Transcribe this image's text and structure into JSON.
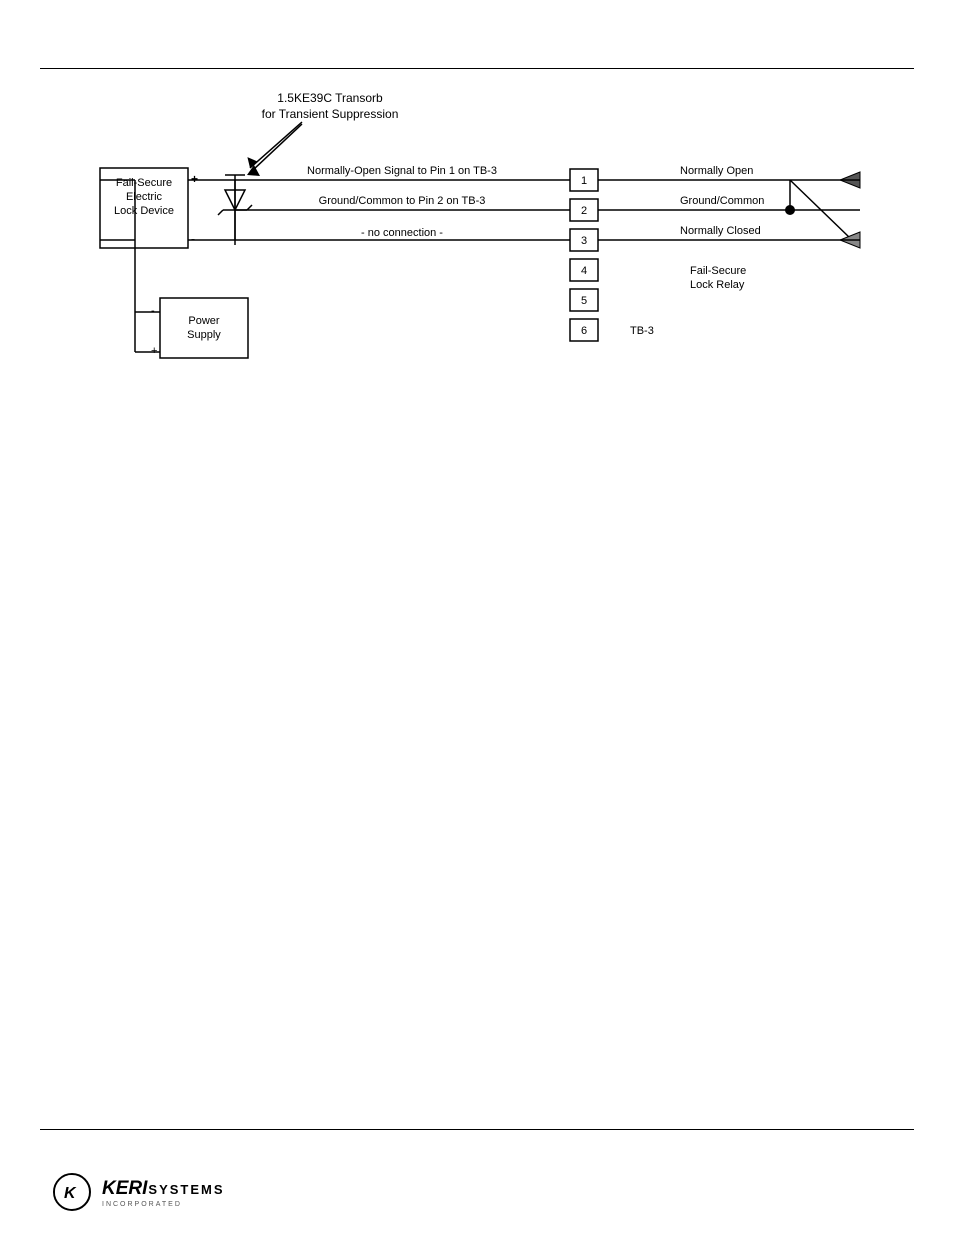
{
  "diagram": {
    "title_line1": "1.5KE39C Transorb",
    "title_line2": "for Transient Suppression",
    "labels": {
      "fail_secure_electric": "Fail-Secure\nElectric\nLock Device",
      "power_supply": "Power Supply",
      "normally_open_signal": "Normally-Open Signal to Pin 1 on TB-3",
      "ground_common": "Ground/Common to Pin 2 on TB-3",
      "no_connection": "- no connection -",
      "normally_open": "Normally Open",
      "ground_common_right": "Ground/Common",
      "normally_closed": "Normally Closed",
      "fail_secure_relay_line1": "Fail-Secure",
      "fail_secure_relay_line2": "Lock Relay",
      "tb3": "TB-3",
      "pin1": "1",
      "pin2": "2",
      "pin3": "3",
      "pin4": "4",
      "pin5": "5",
      "pin6": "6",
      "plus_top": "+",
      "minus_top": "-",
      "plus_bottom": "+",
      "minus_bottom": "-"
    }
  },
  "footer": {
    "brand": "KERI",
    "systems": "SYSTEMS",
    "incorporated": "INCORPORATED"
  }
}
